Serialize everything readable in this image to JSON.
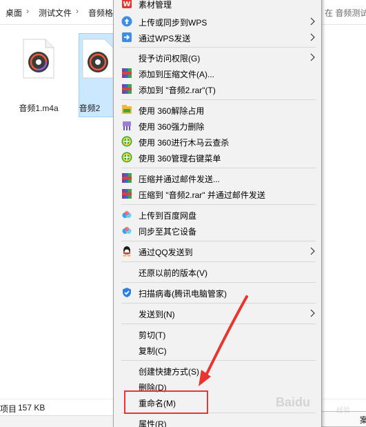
{
  "breadcrumb": {
    "items": [
      "桌面",
      "测试文件",
      "音频格"
    ],
    "search_text": "在 音频测试"
  },
  "files": [
    {
      "name": "音频1.m4a",
      "selected": false
    },
    {
      "name": "音频2",
      "selected": true
    }
  ],
  "status_bar": {
    "items_label": "项目",
    "size": "157 KB",
    "bottom_right_char": "案"
  },
  "context_menu": {
    "partial_top_label": "素材管理",
    "items": [
      {
        "label": "上传或同步到WPS",
        "icon": "wps-cloud-upload-icon",
        "submenu": true
      },
      {
        "label": "通过WPS发送",
        "icon": "wps-send-icon",
        "submenu": true
      },
      {
        "label": "授予访问权限(G)",
        "icon": "",
        "submenu": true
      },
      {
        "label": "添加到压缩文件(A)...",
        "icon": "winrar-icon",
        "submenu": false
      },
      {
        "label": "添加到 \"音频2.rar\"(T)",
        "icon": "winrar-icon",
        "submenu": false
      },
      {
        "label": "使用 360解除占用",
        "icon": "360-unlock-icon",
        "submenu": false
      },
      {
        "label": "使用 360强力删除",
        "icon": "360-shred-icon",
        "submenu": false
      },
      {
        "label": "使用 360进行木马云查杀",
        "icon": "360-scan-icon",
        "submenu": false
      },
      {
        "label": "使用 360管理右键菜单",
        "icon": "360-menu-manager-icon",
        "submenu": false
      },
      {
        "label": "压缩并通过邮件发送...",
        "icon": "winrar-icon",
        "submenu": false
      },
      {
        "label": "压缩到 \"音频2.rar\" 并通过邮件发送",
        "icon": "winrar-icon",
        "submenu": false
      },
      {
        "label": "上传到百度网盘",
        "icon": "baidu-netdisk-icon",
        "submenu": false
      },
      {
        "label": "同步至其它设备",
        "icon": "baidu-netdisk-icon",
        "submenu": false
      },
      {
        "label": "通过QQ发送到",
        "icon": "qq-icon",
        "submenu": true
      },
      {
        "label": "还原以前的版本(V)",
        "icon": "",
        "submenu": false
      },
      {
        "label": "扫描病毒(腾讯电脑管家)",
        "icon": "tencent-shield-icon",
        "submenu": false
      },
      {
        "label": "发送到(N)",
        "icon": "",
        "submenu": true
      },
      {
        "label": "剪切(T)",
        "icon": "",
        "submenu": false
      },
      {
        "label": "复制(C)",
        "icon": "",
        "submenu": false
      },
      {
        "label": "创建快捷方式(S)",
        "icon": "",
        "submenu": false
      },
      {
        "label": "删除(D)",
        "icon": "",
        "submenu": false
      },
      {
        "label": "重命名(M)",
        "icon": "",
        "submenu": false,
        "highlighted": true
      },
      {
        "label": "属性(R)",
        "icon": "",
        "submenu": false
      }
    ]
  },
  "annotation": {
    "highlight_color": "#e8362f"
  },
  "watermark": {
    "brand": "Baidu",
    "sub": "经验"
  }
}
